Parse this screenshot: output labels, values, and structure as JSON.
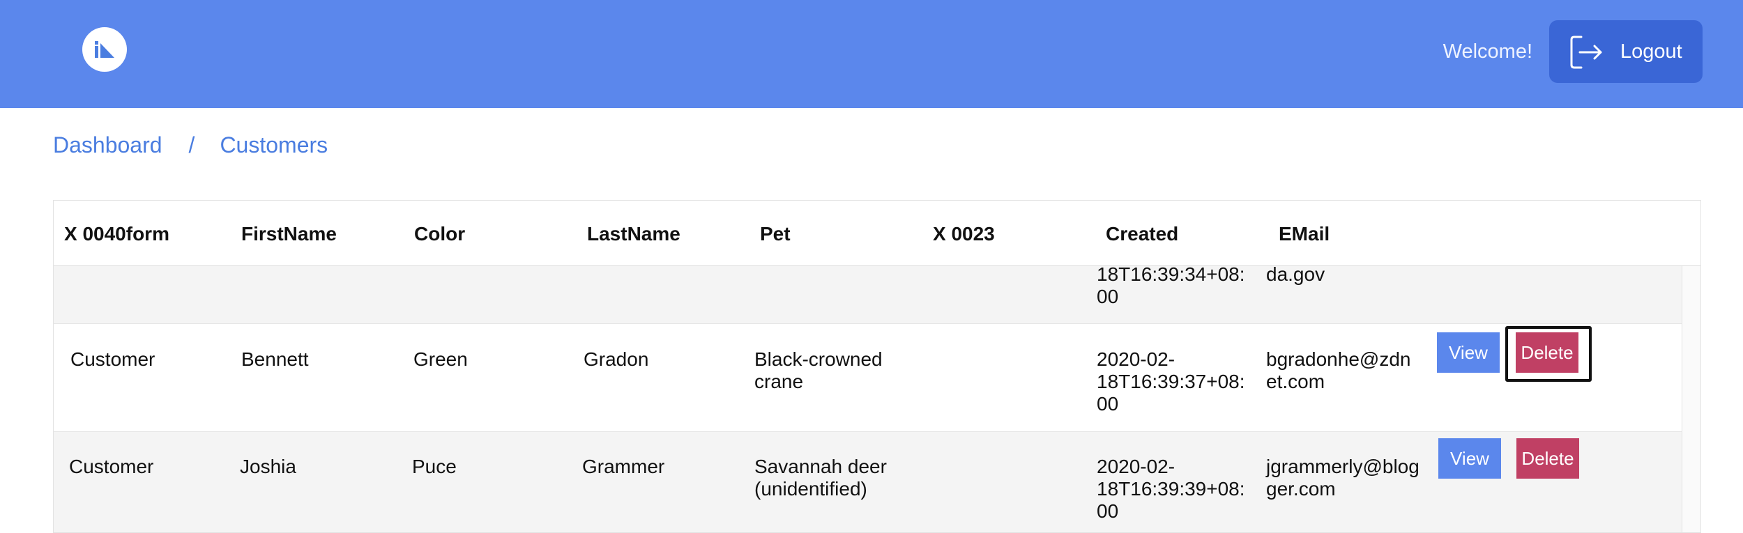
{
  "header": {
    "welcome": "Welcome!",
    "logout_label": "Logout"
  },
  "breadcrumb": {
    "items": [
      "Dashboard",
      "Customers"
    ],
    "separator": "/"
  },
  "table": {
    "columns": [
      "X 0040form",
      "FirstName",
      "Color",
      "LastName",
      "Pet",
      "X 0023",
      "Created",
      "EMail"
    ],
    "partial_row": {
      "created_lines": [
        "18T16:39:34+08:",
        "00"
      ],
      "email_lines": [
        "da.gov"
      ]
    },
    "rows": [
      {
        "form": "Customer",
        "first": "Bennett",
        "color": "Green",
        "last": "Gradon",
        "pet_lines": [
          "Black-crowned",
          "crane"
        ],
        "x0023": "",
        "created_lines": [
          "2020-02-",
          "18T16:39:37+08:",
          "00"
        ],
        "email_lines": [
          "bgradonhe@zdn",
          "et.com"
        ],
        "view_label": "View",
        "delete_label": "Delete"
      },
      {
        "form": "Customer",
        "first": "Joshia",
        "color": "Puce",
        "last": "Grammer",
        "pet_lines": [
          "Savannah deer",
          "(unidentified)"
        ],
        "x0023": "",
        "created_lines": [
          "2020-02-",
          "18T16:39:39+08:",
          "00"
        ],
        "email_lines": [
          "jgrammerly@blog",
          "ger.com"
        ],
        "view_label": "View",
        "delete_label": "Delete"
      }
    ]
  },
  "colors": {
    "header_bg": "#5b87ec",
    "logout_bg": "#3a66d6",
    "link": "#4a7de0",
    "view_button": "#5b87ec",
    "delete_button": "#c04064",
    "row_shade": "#f4f4f4"
  },
  "icons": {
    "logo": "brand-logo-icon",
    "logout": "logout-icon"
  }
}
